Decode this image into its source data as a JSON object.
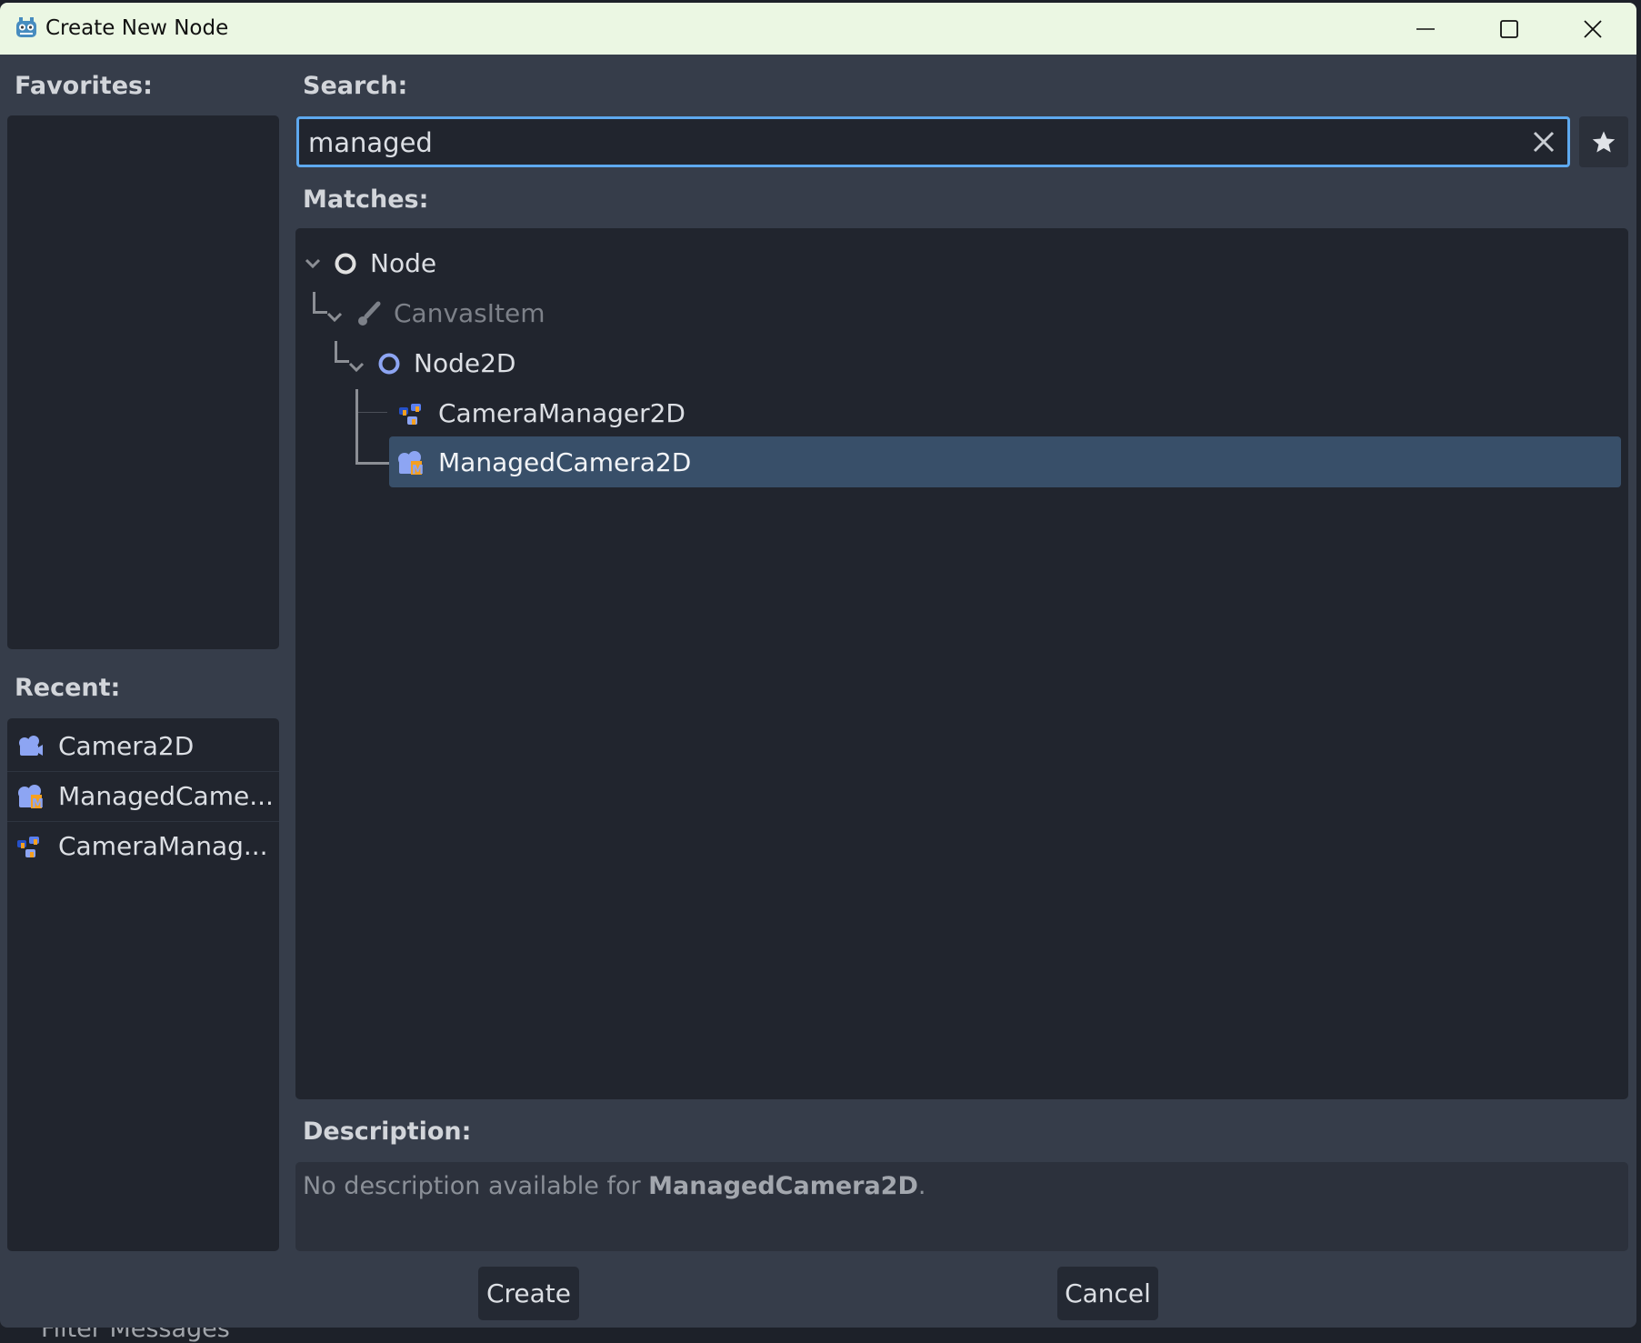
{
  "window": {
    "title": "Create New Node",
    "logo_icon": "godot-logo-icon"
  },
  "favorites": {
    "label": "Favorites:"
  },
  "recent": {
    "label": "Recent:",
    "items": [
      {
        "label": "Camera2D",
        "icon": "camera2d-icon"
      },
      {
        "label": "ManagedCame...",
        "icon": "managed-camera-icon"
      },
      {
        "label": "CameraManag...",
        "icon": "camera-manager-icon"
      }
    ]
  },
  "search": {
    "label": "Search:",
    "value": "managed"
  },
  "matches": {
    "label": "Matches:",
    "tree": [
      {
        "label": "Node",
        "icon": "node-circle-icon",
        "depth": 0
      },
      {
        "label": "CanvasItem",
        "icon": "brush-icon",
        "depth": 1
      },
      {
        "label": "Node2D",
        "icon": "node2d-circle-icon",
        "depth": 2
      },
      {
        "label": "CameraManager2D",
        "icon": "camera-manager-icon",
        "depth": 3
      },
      {
        "label": "ManagedCamera2D",
        "icon": "managed-camera-icon",
        "depth": 3,
        "selected": true
      }
    ]
  },
  "description": {
    "label": "Description:",
    "prefix": "No description available for ",
    "name": "ManagedCamera2D",
    "suffix": "."
  },
  "buttons": {
    "create": "Create",
    "cancel": "Cancel"
  },
  "background": {
    "filter_text": "Filter Messages"
  },
  "colors": {
    "accent": "#5ea9ef",
    "selection": "#384f69",
    "node2d": "#8da5f3",
    "orange": "#f5a020"
  }
}
